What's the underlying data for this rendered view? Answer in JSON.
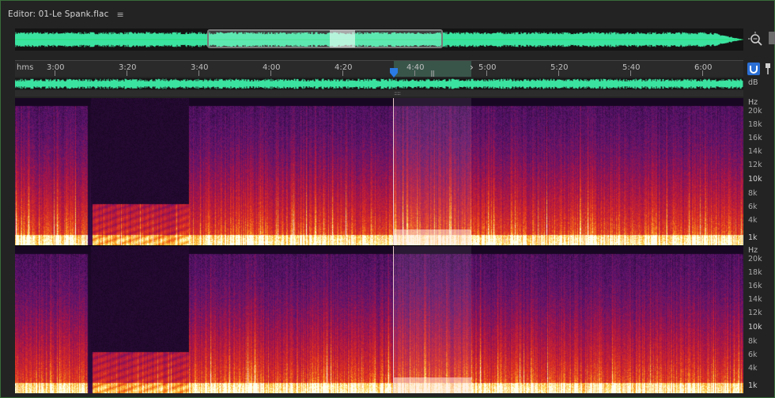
{
  "panel": {
    "title": "Editor: 01-Le Spank.flac",
    "menu_icon": "≡"
  },
  "ruler": {
    "unit": "hms",
    "labels": [
      "3:00",
      "3:20",
      "3:40",
      "4:00",
      "4:20",
      "4:40",
      "5:00",
      "5:20",
      "5:40",
      "6:00"
    ]
  },
  "waveform": {
    "db_label": "dB"
  },
  "freq_axis": {
    "unit": "Hz",
    "labels": [
      "20k",
      "18k",
      "16k",
      "14k",
      "12k",
      "10k",
      "8k",
      "6k",
      "4k",
      "1k"
    ]
  },
  "colors": {
    "waveform": "#3be3a0",
    "playhead": "#2a7be4",
    "accent_button": "#2b6fd4",
    "frame_border": "#3a6b3a"
  },
  "icons": {
    "zoom": "zoom-magnifier-icon",
    "pin": "pin-icon",
    "playhead": "playhead-marker-icon"
  }
}
